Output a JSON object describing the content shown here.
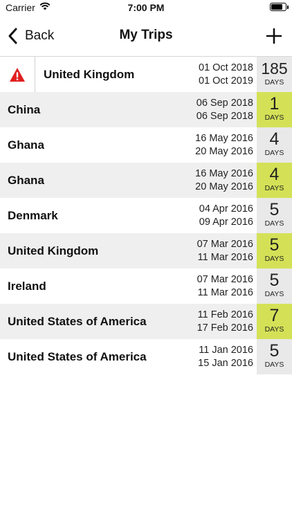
{
  "status_bar": {
    "carrier": "Carrier",
    "time": "7:00 PM",
    "battery_level": 0.8
  },
  "nav": {
    "back_label": "Back",
    "title": "My Trips"
  },
  "accent_color": "#d4e157",
  "warning_color": "#e02020",
  "trips": [
    {
      "country": "United Kingdom",
      "start": "01 Oct 2018",
      "end": "01 Oct 2019",
      "days": "185",
      "days_label": "DAYS",
      "highlight": false,
      "warning": true
    },
    {
      "country": "China",
      "start": "06 Sep 2018",
      "end": "06 Sep 2018",
      "days": "1",
      "days_label": "DAYS",
      "highlight": true,
      "warning": false
    },
    {
      "country": "Ghana",
      "start": "16 May 2016",
      "end": "20 May 2016",
      "days": "4",
      "days_label": "DAYS",
      "highlight": false,
      "warning": false
    },
    {
      "country": "Ghana",
      "start": "16 May 2016",
      "end": "20 May 2016",
      "days": "4",
      "days_label": "DAYS",
      "highlight": true,
      "warning": false
    },
    {
      "country": "Denmark",
      "start": "04 Apr 2016",
      "end": "09 Apr 2016",
      "days": "5",
      "days_label": "DAYS",
      "highlight": false,
      "warning": false
    },
    {
      "country": "United Kingdom",
      "start": "07 Mar 2016",
      "end": "11 Mar 2016",
      "days": "5",
      "days_label": "DAYS",
      "highlight": true,
      "warning": false
    },
    {
      "country": "Ireland",
      "start": "07 Mar 2016",
      "end": "11 Mar 2016",
      "days": "5",
      "days_label": "DAYS",
      "highlight": false,
      "warning": false
    },
    {
      "country": "United States of America",
      "start": "11 Feb 2016",
      "end": "17 Feb 2016",
      "days": "7",
      "days_label": "DAYS",
      "highlight": true,
      "warning": false
    },
    {
      "country": "United States of America",
      "start": "11 Jan 2016",
      "end": "15 Jan 2016",
      "days": "5",
      "days_label": "DAYS",
      "highlight": false,
      "warning": false
    }
  ]
}
